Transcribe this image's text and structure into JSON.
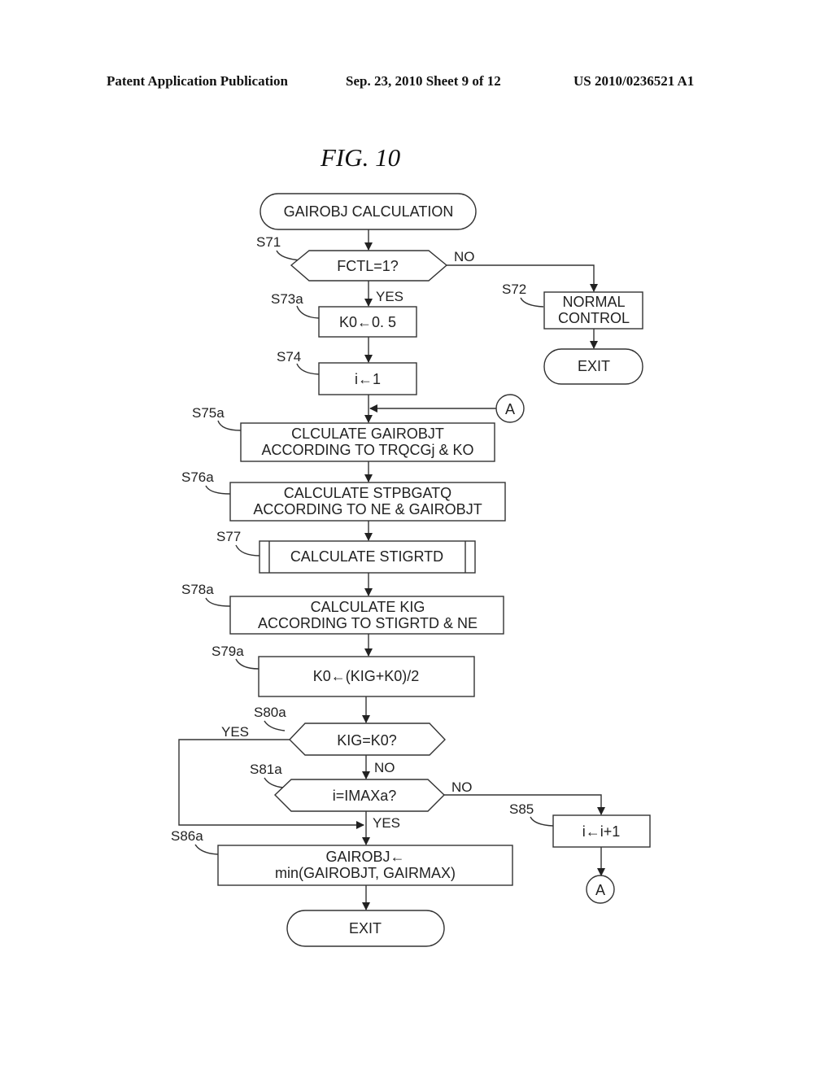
{
  "header": {
    "publication": "Patent Application Publication",
    "date_sheet": "Sep. 23, 2010   Sheet 9 of 12",
    "patent_number": "US 2010/0236521 A1"
  },
  "figure": {
    "title": "FIG. 10"
  },
  "flowchart": {
    "start": {
      "text": "GAIROBJ CALCULATION"
    },
    "nodes": {
      "s71": {
        "step": "S71",
        "type": "decision",
        "text": "FCTL=1?"
      },
      "s72": {
        "step": "S72",
        "type": "process",
        "line1": "NORMAL",
        "line2": "CONTROL"
      },
      "s72_exit": {
        "type": "terminal",
        "text": "EXIT"
      },
      "s73a": {
        "step": "S73a",
        "type": "process",
        "text": "K0←0. 5"
      },
      "s74": {
        "step": "S74",
        "type": "process",
        "text": "i←1"
      },
      "s75a": {
        "step": "S75a",
        "type": "process",
        "line1": "CLCULATE GAIROBJT",
        "line2": "ACCORDING TO TRQCGj & KO"
      },
      "s76a": {
        "step": "S76a",
        "type": "process",
        "line1": "CALCULATE STPBGATQ",
        "line2": "ACCORDING TO NE & GAIROBJT"
      },
      "s77": {
        "step": "S77",
        "type": "subroutine",
        "text": "CALCULATE STIGRTD"
      },
      "s78a": {
        "step": "S78a",
        "type": "process",
        "line1": "CALCULATE KIG",
        "line2": "ACCORDING TO STIGRTD & NE"
      },
      "s79a": {
        "step": "S79a",
        "type": "process",
        "text": "K0←(KIG+K0)/2"
      },
      "s80a": {
        "step": "S80a",
        "type": "decision",
        "text": "KIG=K0?"
      },
      "s81a": {
        "step": "S81a",
        "type": "decision",
        "text": "i=IMAXa?"
      },
      "s85": {
        "step": "S85",
        "type": "process",
        "text": "i←i+1"
      },
      "s86a": {
        "step": "S86a",
        "type": "process",
        "line1": "GAIROBJ←",
        "line2": "min(GAIROBJT, GAIRMAX)"
      },
      "end_exit": {
        "type": "terminal",
        "text": "EXIT"
      }
    },
    "connectors": {
      "a_in": "A",
      "a_out": "A"
    },
    "branch_labels": {
      "s71_no": "NO",
      "s71_yes": "YES",
      "s80a_yes": "YES",
      "s80a_no": "NO",
      "s81a_no": "NO",
      "s81a_yes": "YES"
    }
  }
}
